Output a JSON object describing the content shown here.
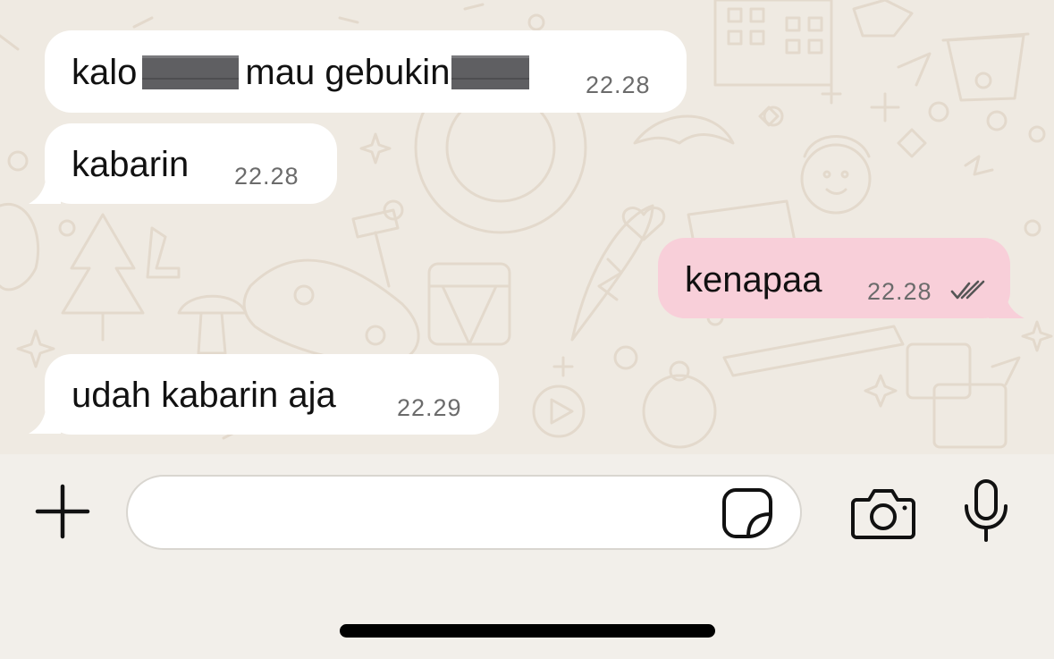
{
  "messages": [
    {
      "direction": "incoming",
      "text_parts": [
        "kalo",
        "mau gebukin"
      ],
      "redacted_segments": 2,
      "time": "22.28"
    },
    {
      "direction": "incoming",
      "text": "kabarin",
      "time": "22.28"
    },
    {
      "direction": "outgoing",
      "text": "kenapaa",
      "time": "22.28",
      "status": "read-double-check"
    },
    {
      "direction": "incoming",
      "text": "udah kabarin aja",
      "time": "22.29"
    }
  ],
  "composer": {
    "input_value": "",
    "input_placeholder": "",
    "icons": [
      "plus-icon",
      "sticker-icon",
      "camera-icon",
      "microphone-icon"
    ]
  },
  "colors": {
    "wallpaper": "#efeae2",
    "incoming_bubble": "#ffffff",
    "outgoing_bubble": "#f8cfd9",
    "composer_bar": "#f2efea",
    "timestamp": "#6b6b6b"
  }
}
